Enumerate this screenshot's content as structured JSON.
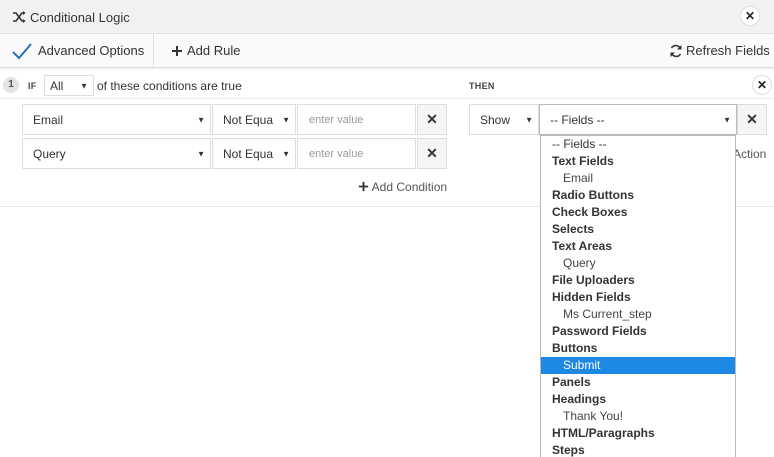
{
  "header": {
    "title": "Conditional Logic"
  },
  "toolbar": {
    "advanced_options": "Advanced Options",
    "add_rule": "Add Rule",
    "refresh_fields": "Refresh Fields"
  },
  "rule": {
    "number": "1",
    "if_label": "IF",
    "match_value": "All",
    "match_suffix": "of these conditions are true",
    "then_label": "THEN",
    "conditions": [
      {
        "field": "Email",
        "operator": "Not Equa",
        "value_placeholder": "enter value"
      },
      {
        "field": "Query",
        "operator": "Not Equa",
        "value_placeholder": "enter value"
      }
    ],
    "add_condition": "Add Condition",
    "action": {
      "verb": "Show",
      "field": "-- Fields --",
      "action_label": "Action"
    }
  },
  "dropdown": {
    "items": [
      {
        "label": "-- Fields --",
        "kind": "option"
      },
      {
        "label": "Text Fields",
        "kind": "group"
      },
      {
        "label": "Email",
        "kind": "child"
      },
      {
        "label": "Radio Buttons",
        "kind": "group"
      },
      {
        "label": "Check Boxes",
        "kind": "group"
      },
      {
        "label": "Selects",
        "kind": "group"
      },
      {
        "label": "Text Areas",
        "kind": "group"
      },
      {
        "label": "Query",
        "kind": "child"
      },
      {
        "label": "File Uploaders",
        "kind": "group"
      },
      {
        "label": "Hidden Fields",
        "kind": "group"
      },
      {
        "label": "Ms Current_step",
        "kind": "child"
      },
      {
        "label": "Password Fields",
        "kind": "group"
      },
      {
        "label": "Buttons",
        "kind": "group"
      },
      {
        "label": "Submit",
        "kind": "child",
        "selected": true
      },
      {
        "label": "Panels",
        "kind": "group"
      },
      {
        "label": "Headings",
        "kind": "group"
      },
      {
        "label": "Thank You!",
        "kind": "child"
      },
      {
        "label": "HTML/Paragraphs",
        "kind": "group"
      },
      {
        "label": "Steps",
        "kind": "group"
      }
    ]
  },
  "colors": {
    "accent": "#1e88e5",
    "check": "#2a6fb8"
  },
  "icons": {
    "shuffle": "shuffle-icon",
    "close": "close-icon",
    "check": "check-icon",
    "plus": "plus-icon",
    "refresh": "refresh-icon",
    "caret": "caret-down-icon",
    "remove": "remove-icon"
  }
}
